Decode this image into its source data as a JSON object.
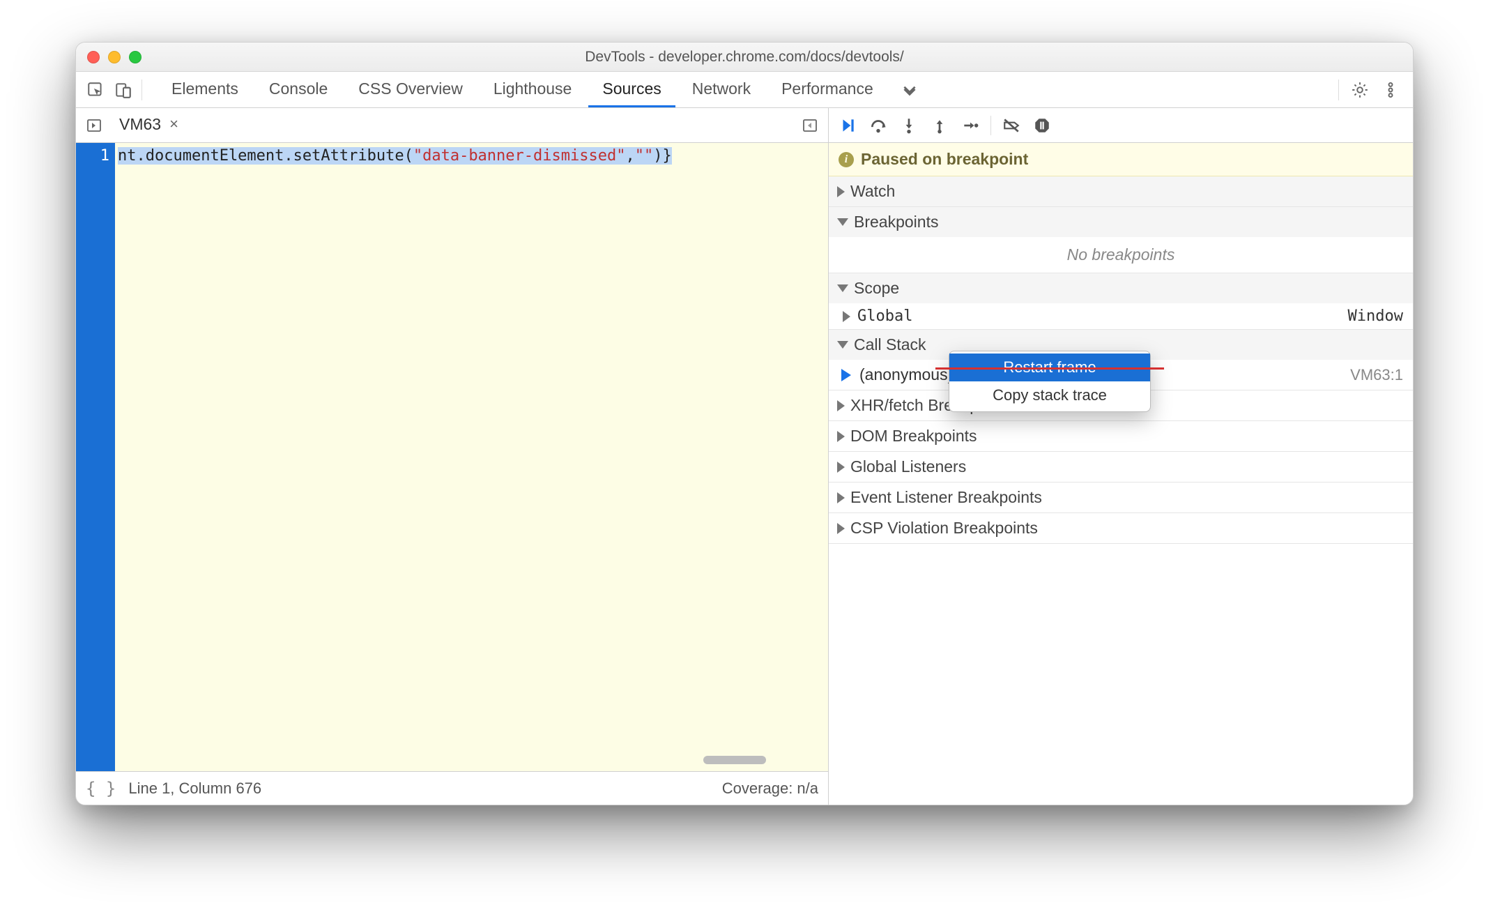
{
  "window": {
    "title": "DevTools - developer.chrome.com/docs/devtools/"
  },
  "main_tabs": [
    "Elements",
    "Console",
    "CSS Overview",
    "Lighthouse",
    "Sources",
    "Network",
    "Performance"
  ],
  "active_main_tab": "Sources",
  "file_tab": {
    "name": "VM63"
  },
  "code": {
    "line_number": "1",
    "prefix": "nt.documentElement.setAttribute(",
    "string": "\"data-banner-dismissed\"",
    "mid": ",",
    "string2": "\"\"",
    "suffix": ")}"
  },
  "status": {
    "cursor": "Line 1, Column 676",
    "coverage": "Coverage: n/a"
  },
  "pause_message": "Paused on breakpoint",
  "sections": {
    "watch": "Watch",
    "breakpoints": "Breakpoints",
    "no_breakpoints": "No breakpoints",
    "scope": "Scope",
    "scope_global": "Global",
    "scope_global_val": "Window",
    "call_stack": "Call Stack",
    "stack_frame": "(anonymous)",
    "stack_loc": "VM63:1",
    "xhr": "XHR/fetch Breakp",
    "dom": "DOM Breakpoints",
    "global_listeners": "Global Listeners",
    "event_listener": "Event Listener Breakpoints",
    "csp": "CSP Violation Breakpoints"
  },
  "context_menu": {
    "restart": "Restart frame",
    "copy": "Copy stack trace"
  }
}
